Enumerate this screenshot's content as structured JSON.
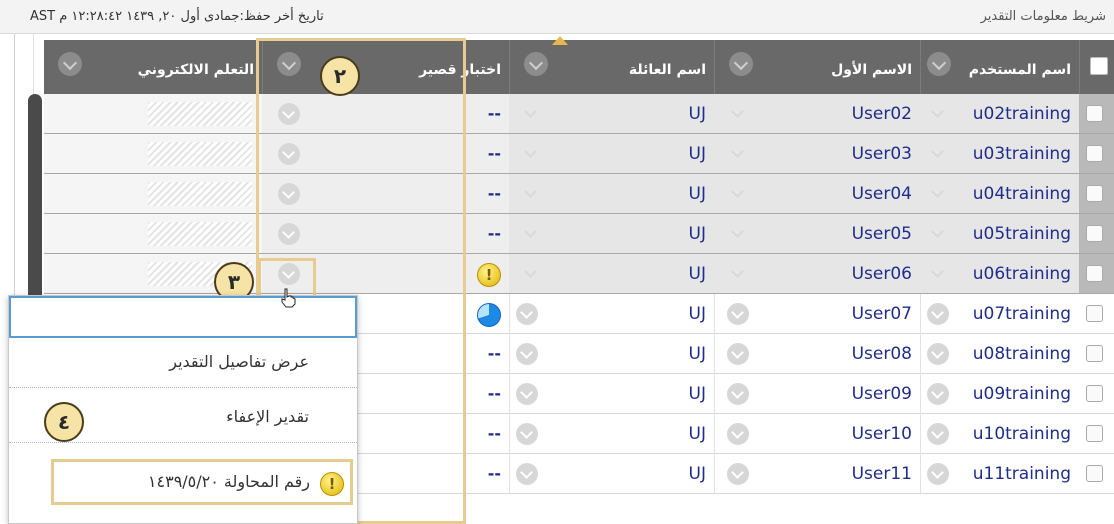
{
  "info_bar": {
    "title": "شريط معلومات التقدير",
    "last_saved": "تاريخ أخر حفظ:جمادى أول ٢٠, ١٤٣٩ ١٢:٢٨:٤٢ م AST"
  },
  "columns": {
    "username": "اسم المستخدم",
    "first_name": "الاسم الأول",
    "last_name": "اسم العائلة",
    "quiz": "اختبار قصير",
    "elearning": "التعلم الالكتروني"
  },
  "rows": [
    {
      "username": "u02training",
      "first_name": "User02",
      "last_name": "UJ",
      "quiz": "--"
    },
    {
      "username": "u03training",
      "first_name": "User03",
      "last_name": "UJ",
      "quiz": "--"
    },
    {
      "username": "u04training",
      "first_name": "User04",
      "last_name": "UJ",
      "quiz": "--"
    },
    {
      "username": "u05training",
      "first_name": "User05",
      "last_name": "UJ",
      "quiz": "--"
    },
    {
      "username": "u06training",
      "first_name": "User06",
      "last_name": "UJ",
      "quiz": "!"
    },
    {
      "username": "u07training",
      "first_name": "User07",
      "last_name": "UJ",
      "quiz": ""
    },
    {
      "username": "u08training",
      "first_name": "User08",
      "last_name": "UJ",
      "quiz": "--"
    },
    {
      "username": "u09training",
      "first_name": "User09",
      "last_name": "UJ",
      "quiz": "--"
    },
    {
      "username": "u10training",
      "first_name": "User10",
      "last_name": "UJ",
      "quiz": "--"
    },
    {
      "username": "u11training",
      "first_name": "User11",
      "last_name": "UJ",
      "quiz": "--"
    }
  ],
  "menu": {
    "view_grade_details": "عرض تفاصيل التقدير",
    "exempt_grade": "تقدير الإعفاء",
    "attempt": "رقم المحاولة ١٤٣٩/٥/٢٠"
  },
  "badges": {
    "b2": "٢",
    "b3": "٣",
    "b4": "٤"
  },
  "colors": {
    "header_bg": "#696969",
    "link_blue": "#1f2d8a",
    "highlight_gold": "#e6cc8e",
    "focus_blue": "#5b9bd5"
  }
}
